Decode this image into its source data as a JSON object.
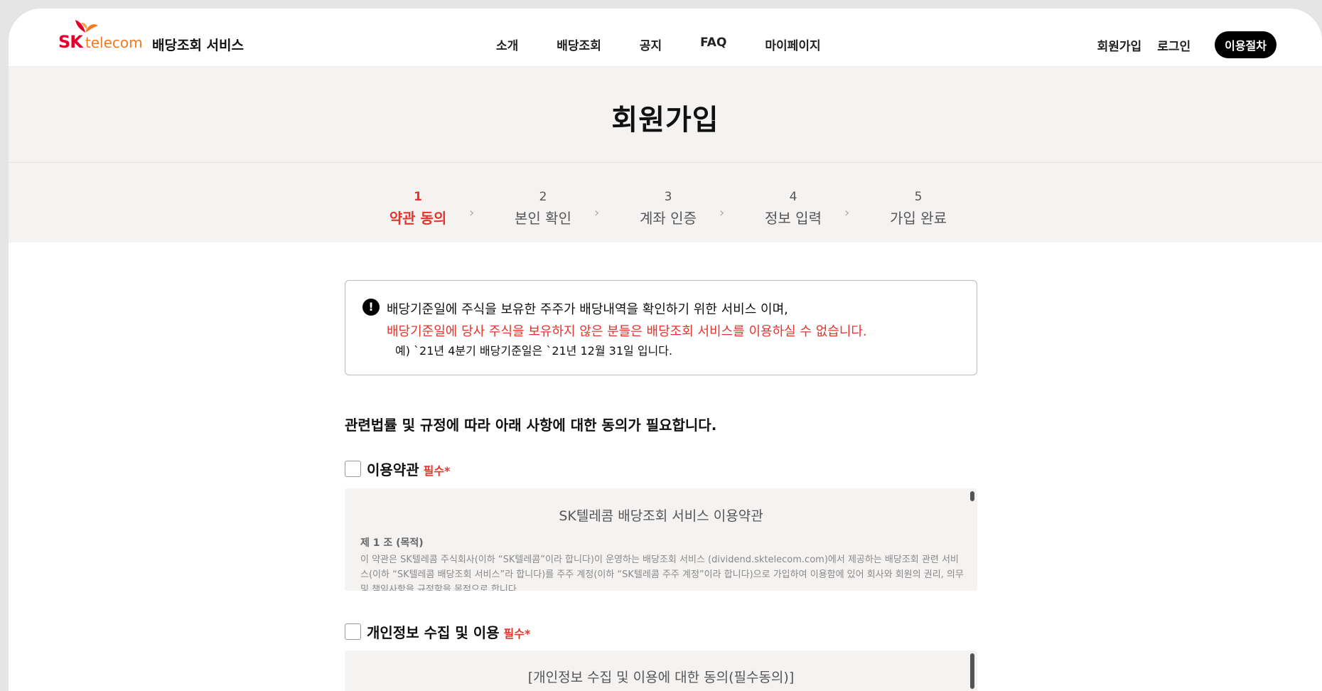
{
  "header": {
    "logo_sk": "SK",
    "logo_telecom": "telecom",
    "service_name": "배당조회 서비스",
    "nav": [
      "소개",
      "배당조회",
      "공지",
      "FAQ",
      "마이페이지"
    ],
    "signup": "회원가입",
    "login": "로그인",
    "guide_button": "이용절차"
  },
  "page_title": "회원가입",
  "steps": [
    {
      "num": "1",
      "label": "약관 동의"
    },
    {
      "num": "2",
      "label": "본인 확인"
    },
    {
      "num": "3",
      "label": "계좌 인증"
    },
    {
      "num": "4",
      "label": "정보 입력"
    },
    {
      "num": "5",
      "label": "가입 완료"
    }
  ],
  "notice": {
    "icon": "!",
    "line1": "배당기준일에 주식을 보유한 주주가 배당내역을 확인하기 위한 서비스 이며,",
    "line2": "배당기준일에 당사 주식을 보유하지 않은 분들은 배당조회 서비스를 이용하실 수 없습니다.",
    "line3": "예) `21년 4분기 배당기준일은 `21년 12월 31일 입니다."
  },
  "agree_heading": "관련법률 및 규정에 따라 아래 사항에 대한 동의가 필요합니다.",
  "terms": [
    {
      "title": "이용약관",
      "required": "필수*",
      "box_title": "SK텔레콤 배당조회 서비스 이용약관",
      "article_title": "제 1 조 (목적)",
      "article_body": "이 약관은 SK텔레콤 주식회사(이하 “SK텔레콤”이라 합니다)이 운영하는 배당조회 서비스 (dividend.sktelecom.com)에서 제공하는 배당조회 관련 서비스(이하 “SK텔레콤 배당조회 서비스”라 합니다)를 주주 계정(이하 “SK텔레콤 주주 계정”이라 합니다)으로 가입하여 이용함에 있어 회사와 회원의 권리, 의무 및 책임사항을 규정함을 목적으로 합니다."
    },
    {
      "title": "개인정보 수집 및 이용",
      "required": "필수*",
      "box_title": "[개인정보 수집 및 이용에 대한 동의(필수동의)]"
    }
  ],
  "colors": {
    "accent": "#e4352c",
    "band_bg": "#f5f3f2",
    "brand_red": "#e4002b",
    "brand_orange": "#f47920"
  }
}
